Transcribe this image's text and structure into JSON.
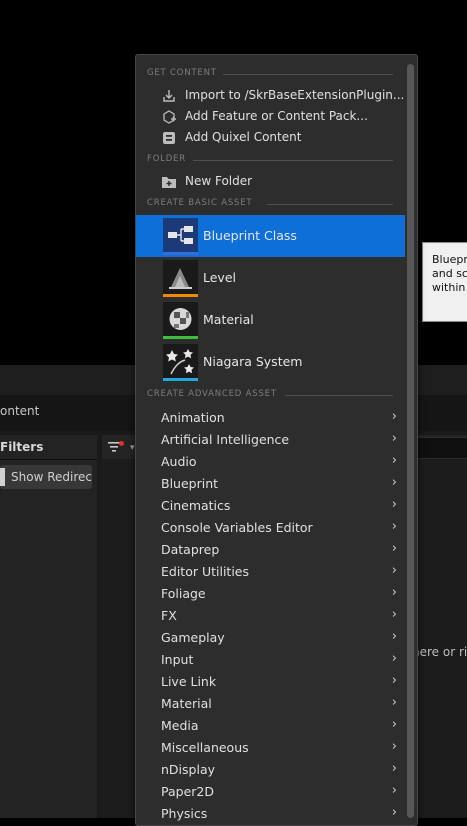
{
  "background": {
    "path_text": "ontent",
    "filters_title": "Filters",
    "show_redirectors_label": "Show Redirec",
    "drop_hint_text": "here or ri",
    "tooltip_text": "Bluepr\nand sc\nwithin"
  },
  "menu": {
    "sections": {
      "get_content": "GET CONTENT",
      "folder": "FOLDER",
      "create_basic": "CREATE BASIC ASSET",
      "create_advanced": "CREATE ADVANCED ASSET"
    },
    "get_content_items": [
      {
        "label": "Import to /SkrBaseExtensionPlugin...",
        "icon": "import-icon"
      },
      {
        "label": "Add Feature or Content Pack...",
        "icon": "feature-pack-icon"
      },
      {
        "label": "Add Quixel Content",
        "icon": "quixel-icon"
      }
    ],
    "folder_items": [
      {
        "label": "New Folder",
        "icon": "new-folder-icon"
      }
    ],
    "basic_assets": [
      {
        "label": "Blueprint Class",
        "icon": "blueprint-class-icon",
        "stripe_color": "#2f6fde",
        "selected": true
      },
      {
        "label": "Level",
        "icon": "level-icon",
        "stripe_color": "#f08a00",
        "selected": false
      },
      {
        "label": "Material",
        "icon": "material-icon",
        "stripe_color": "#3fbf3f",
        "selected": false
      },
      {
        "label": "Niagara System",
        "icon": "niagara-system-icon",
        "stripe_color": "#20a8e0",
        "selected": false
      }
    ],
    "advanced_assets": [
      "Animation",
      "Artificial Intelligence",
      "Audio",
      "Blueprint",
      "Cinematics",
      "Console Variables Editor",
      "Dataprep",
      "Editor Utilities",
      "Foliage",
      "FX",
      "Gameplay",
      "Input",
      "Live Link",
      "Material",
      "Media",
      "Miscellaneous",
      "nDisplay",
      "Paper2D",
      "Physics"
    ],
    "submenu_arrow": "›"
  },
  "colors": {
    "selection": "#0e6fd8",
    "menu_bg": "#2d2d2d"
  }
}
